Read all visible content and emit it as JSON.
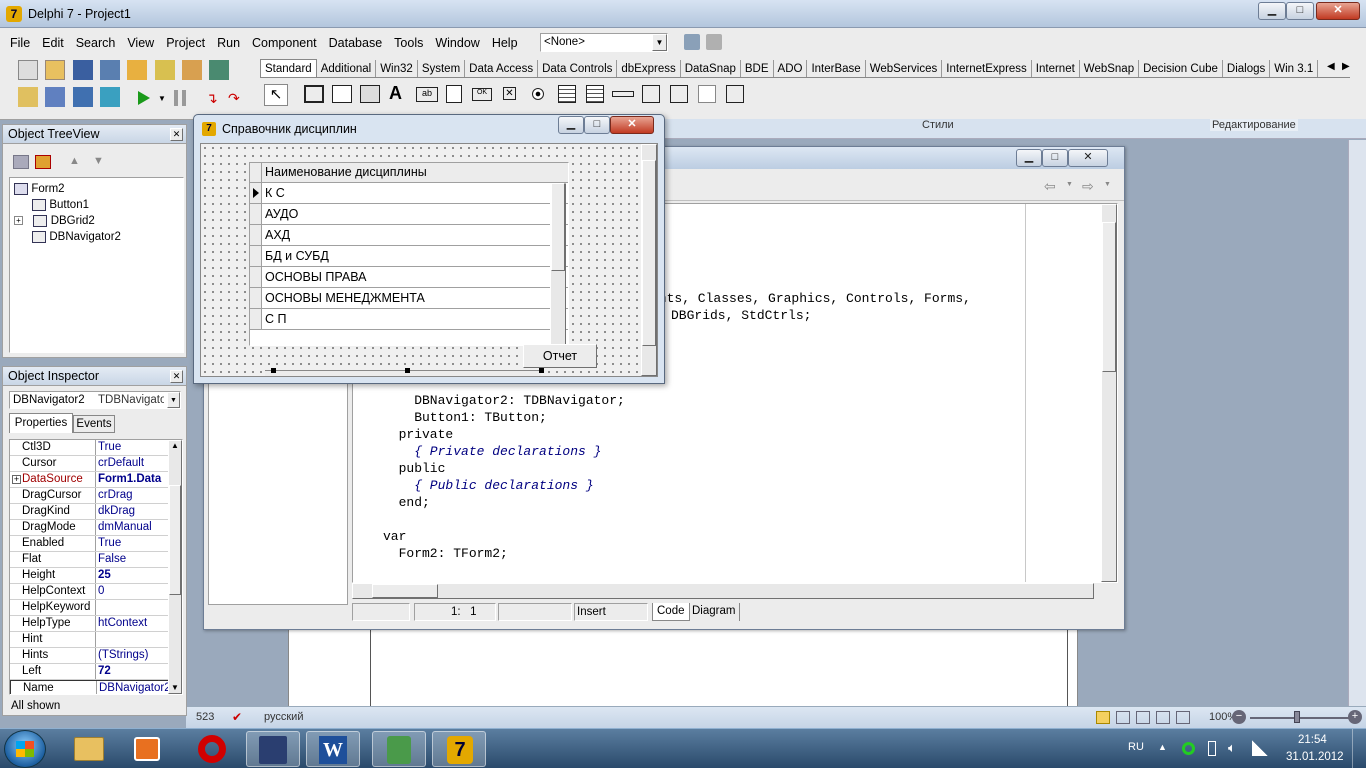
{
  "window": {
    "title": "Delphi 7 - Project1"
  },
  "menu": [
    "File",
    "Edit",
    "Search",
    "View",
    "Project",
    "Run",
    "Component",
    "Database",
    "Tools",
    "Window",
    "Help"
  ],
  "desktop_combo": "<None>",
  "palette_tabs": [
    "Standard",
    "Additional",
    "Win32",
    "System",
    "Data Access",
    "Data Controls",
    "dbExpress",
    "DataSnap",
    "BDE",
    "ADO",
    "InterBase",
    "WebServices",
    "InternetExpress",
    "Internet",
    "WebSnap",
    "Decision Cube",
    "Dialogs",
    "Win 3.1"
  ],
  "treeview": {
    "title": "Object TreeView",
    "items": [
      "Form2",
      "Button1",
      "DBGrid2",
      "DBNavigator2"
    ]
  },
  "inspector": {
    "title": "Object Inspector",
    "selected_name": "DBNavigator2",
    "selected_type": "TDBNavigator",
    "tabs": [
      "Properties",
      "Events"
    ],
    "rows": [
      {
        "name": "Ctl3D",
        "value": "True"
      },
      {
        "name": "Cursor",
        "value": "crDefault"
      },
      {
        "name": "DataSource",
        "value": "Form1.Data"
      },
      {
        "name": "DragCursor",
        "value": "crDrag"
      },
      {
        "name": "DragKind",
        "value": "dkDrag"
      },
      {
        "name": "DragMode",
        "value": "dmManual"
      },
      {
        "name": "Enabled",
        "value": "True"
      },
      {
        "name": "Flat",
        "value": "False"
      },
      {
        "name": "Height",
        "value": "25"
      },
      {
        "name": "HelpContext",
        "value": "0"
      },
      {
        "name": "HelpKeyword",
        "value": ""
      },
      {
        "name": "HelpType",
        "value": "htContext"
      },
      {
        "name": "Hint",
        "value": ""
      },
      {
        "name": "Hints",
        "value": "(TStrings)"
      },
      {
        "name": "Left",
        "value": "72"
      },
      {
        "name": "Name",
        "value": "DBNavigator2"
      }
    ],
    "status": "All shown"
  },
  "form": {
    "title": "Справочник дисциплин",
    "grid_header": "Наименование дисциплины",
    "grid_rows": [
      "К С",
      "АУДО",
      "АХД",
      "БД и СУБД",
      "ОСНОВЫ ПРАВА",
      "ОСНОВЫ МЕНЕДЖМЕНТА",
      "С П"
    ],
    "button_label": "Отчет"
  },
  "editor": {
    "code_lines": [
      {
        "t": "ants, Classes, Graphics, Controls, Forms,",
        "x": 0
      },
      {
        "t": "DBGrids, StdCtrls;",
        "x": 0
      }
    ],
    "code_lower": [
      {
        "t": "    DBNavigator2: TDBNavigator;",
        "c": ""
      },
      {
        "t": "    Button1: TButton;",
        "c": ""
      },
      {
        "t": "  private",
        "c": ""
      },
      {
        "t": "    { Private declarations }",
        "c": "cm"
      },
      {
        "t": "  public",
        "c": ""
      },
      {
        "t": "    { Public declarations }",
        "c": "cm"
      },
      {
        "t": "  end;",
        "c": ""
      },
      {
        "t": "",
        "c": ""
      },
      {
        "t": "var",
        "c": ""
      },
      {
        "t": "  Form2: TForm2;",
        "c": ""
      }
    ],
    "status_pos": "1:   1",
    "status_mode": "Insert",
    "tab_code": "Code",
    "tab_diagram": "Diagram"
  },
  "background_window": {
    "styles": "Стили",
    "editing": "Редактирование",
    "zoom": "100%",
    "status_num": "523",
    "status_lang": "русский"
  },
  "taskbar": {
    "lang": "RU",
    "time": "21:54",
    "date": "31.01.2012"
  }
}
